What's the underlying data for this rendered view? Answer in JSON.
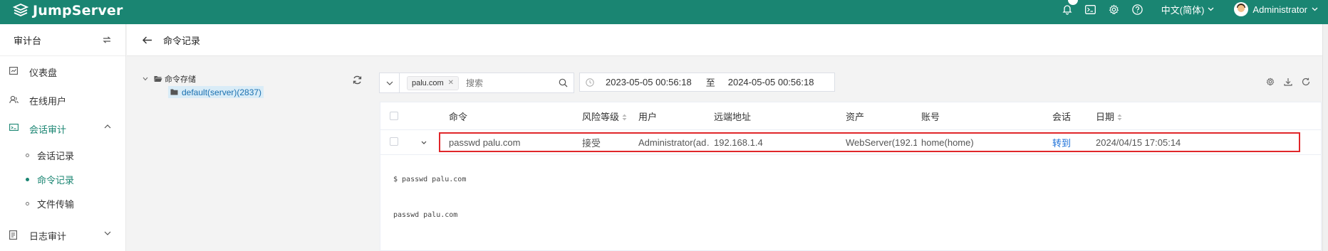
{
  "brand": {
    "name": "JumpServer",
    "accent": "#1a8572"
  },
  "topbar": {
    "icons": [
      "bell-icon",
      "terminal-icon",
      "gear-icon",
      "help-icon"
    ],
    "language": "中文(简体)",
    "username": "Administrator"
  },
  "sidebar": {
    "title": "审计台",
    "items": [
      {
        "label": "仪表盘",
        "icon": "dashboard-icon"
      },
      {
        "label": "在线用户",
        "icon": "users-icon"
      },
      {
        "label": "会话审计",
        "icon": "session-icon"
      },
      {
        "label": "日志审计",
        "icon": "log-icon"
      }
    ],
    "subitems": [
      {
        "label": "会话记录"
      },
      {
        "label": "命令记录"
      },
      {
        "label": "文件传输"
      }
    ]
  },
  "page": {
    "title": "命令记录"
  },
  "tree": {
    "root": "命令存储",
    "child": "default(server)(2837)"
  },
  "filter": {
    "tag": "palu.com",
    "placeholder": "搜索"
  },
  "daterange": {
    "start": "2023-05-05 00:56:18",
    "separator": "至",
    "end": "2024-05-05 00:56:18"
  },
  "table": {
    "headers": {
      "command": "命令",
      "risk": "风险等级",
      "user": "用户",
      "remote": "远端地址",
      "asset": "资产",
      "account": "账号",
      "session": "会话",
      "date": "日期"
    },
    "rows": [
      {
        "command": "passwd palu.com",
        "risk": "接受",
        "user": "Administrator(ad…",
        "remote": "192.168.1.4",
        "asset": "WebServer(192.1…",
        "account": "home(home)",
        "session": "转到",
        "date": "2024/04/15 17:05:14"
      }
    ],
    "expanded": {
      "line1": "$ passwd palu.com",
      "line2": "passwd palu.com"
    }
  }
}
